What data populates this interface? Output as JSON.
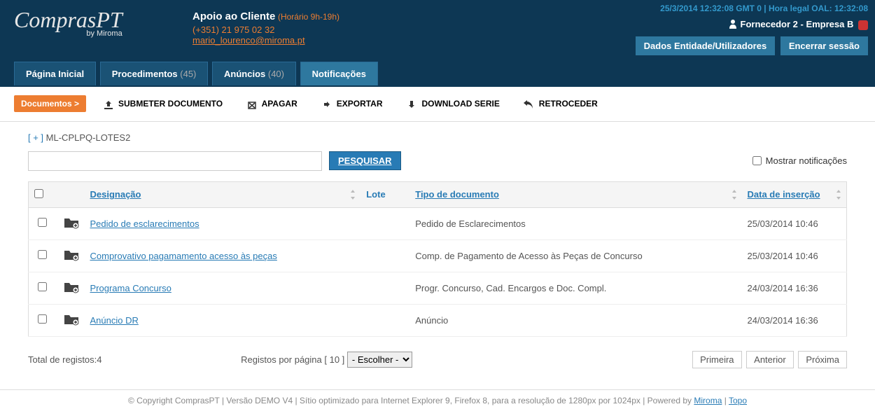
{
  "header": {
    "logo": "ComprasPT",
    "logo_sub": "by Miroma",
    "support_title": "Apoio ao Cliente",
    "support_hours": "(Horário 9h-19h)",
    "support_phone": "(+351) 21 975 02 32",
    "support_email": "mario_lourenco@miroma.pt",
    "datetime": "25/3/2014 12:32:08 GMT 0 | Hora legal OAL: 12:32:08",
    "user": "Fornecedor 2 - Empresa B",
    "btn_entity": "Dados Entidade/Utilizadores",
    "btn_logout": "Encerrar sessão"
  },
  "nav": {
    "home": "Página Inicial",
    "procs": "Procedimentos",
    "procs_count": "(45)",
    "anuncios": "Anúncios",
    "anuncios_count": "(40)",
    "notif": "Notificações"
  },
  "toolbar": {
    "documentos": "Documentos >",
    "submeter": "SUBMETER DOCUMENTO",
    "apagar": "APAGAR",
    "exportar": "EXPORTAR",
    "download": "DOWNLOAD SERIE",
    "retro": "RETROCEDER"
  },
  "breadcrumb": {
    "plus": "[ + ]",
    "path": "ML-CPLPQ-LOTES2"
  },
  "search": {
    "btn": "PESQUISAR",
    "notif_label": "Mostrar notificações"
  },
  "table": {
    "headers": {
      "desig": "Designação",
      "lote": "Lote",
      "tipo": "Tipo de documento",
      "data": "Data de inserção"
    },
    "rows": [
      {
        "desig": "Pedido de esclarecimentos",
        "lote": "",
        "tipo": "Pedido de Esclarecimentos",
        "data": "25/03/2014 10:46"
      },
      {
        "desig": "Comprovativo pagamamento acesso às peças",
        "lote": "",
        "tipo": "Comp. de Pagamento de Acesso às Peças de Concurso",
        "data": "25/03/2014 10:46"
      },
      {
        "desig": "Programa Concurso",
        "lote": "",
        "tipo": "Progr. Concurso, Cad. Encargos e Doc. Compl.",
        "data": "24/03/2014 16:36"
      },
      {
        "desig": "Anúncio DR",
        "lote": "",
        "tipo": "Anúncio",
        "data": "24/03/2014 16:36"
      }
    ]
  },
  "pager": {
    "total_label": "Total de registos:",
    "total_count": "4",
    "per_page_label": "Registos por página [ 10 ]",
    "select_default": "- Escolher -",
    "first": "Primeira",
    "prev": "Anterior",
    "next": "Próxima"
  },
  "footer": {
    "copyright": "© Copyright ComprasPT | Versão DEMO V4 | Sítio optimizado para Internet Explorer 9, Firefox 8, para a resolução de 1280px por 1024px | Powered by ",
    "miroma": "Miroma",
    "sep": " | ",
    "topo": "Topo"
  }
}
